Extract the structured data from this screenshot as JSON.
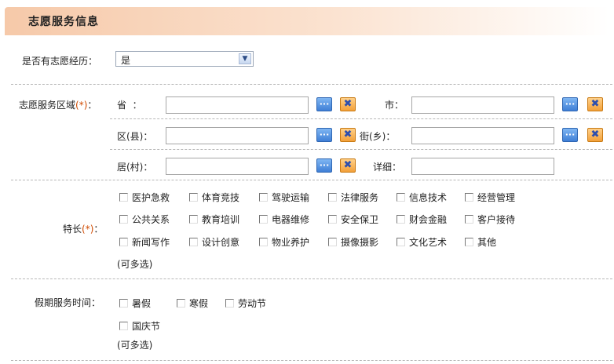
{
  "section": {
    "title": "志愿服务信息"
  },
  "experience": {
    "label": "是否有志愿经历：",
    "selected": "是"
  },
  "region": {
    "label": "志愿服务区域",
    "required_mark": "(*)",
    "label_colon": "：",
    "province_label": "省  ：",
    "city_label": "市：",
    "district_label": "区(县)：",
    "street_label": "街(乡)：",
    "village_label": "居(村)：",
    "detail_label": "详细：",
    "more_glyph": "···",
    "clear_glyph": "✖"
  },
  "skills": {
    "label": "特长",
    "required_mark": "(*)",
    "label_colon": "：",
    "note": "(可多选)",
    "options": [
      "医护急救",
      "体育竞技",
      "驾驶运输",
      "法律服务",
      "信息技术",
      "经营管理",
      "公共关系",
      "教育培训",
      "电器维修",
      "安全保卫",
      "财会金融",
      "客户接待",
      "新闻写作",
      "设计创意",
      "物业养护",
      "摄像摄影",
      "文化艺术",
      "其他"
    ]
  },
  "holiday": {
    "label": "假期服务时间：",
    "note": "(可多选)",
    "options": [
      "暑假",
      "寒假",
      "劳动节",
      "国庆节"
    ]
  }
}
